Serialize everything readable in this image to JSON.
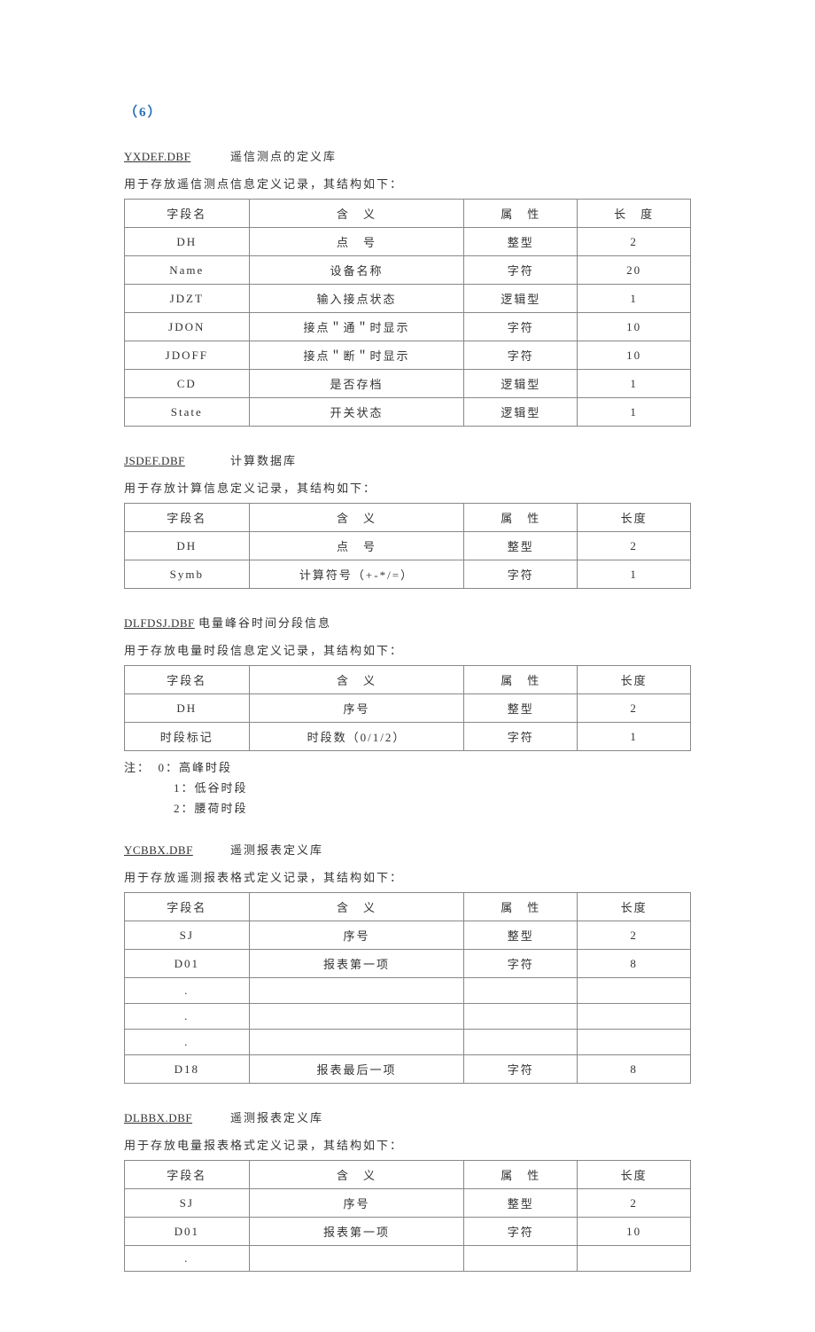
{
  "page_number": "（6）",
  "headers": {
    "field": "字段名",
    "meaning": "含　义",
    "attr": "属　性",
    "len": "长　度",
    "len_short": "长度"
  },
  "sections": [
    {
      "db_name": "YXDEF.DBF",
      "db_desc": "遥信测点的定义库",
      "sub": "用于存放遥信测点信息定义记录，其结构如下：",
      "len_header_key": "len",
      "rows": [
        {
          "name": "DH",
          "mean": "点　号",
          "attr": "整型",
          "len": "2"
        },
        {
          "name": "Name",
          "mean": "设备名称",
          "attr": "字符",
          "len": "20"
        },
        {
          "name": "JDZT",
          "mean": "输入接点状态",
          "attr": "逻辑型",
          "len": "1"
        },
        {
          "name": "JDON",
          "mean": "接点＂通＂时显示",
          "attr": "字符",
          "len": "10"
        },
        {
          "name": "JDOFF",
          "mean": "接点＂断＂时显示",
          "attr": "字符",
          "len": "10"
        },
        {
          "name": "CD",
          "mean": "是否存档",
          "attr": "逻辑型",
          "len": "1"
        },
        {
          "name": "State",
          "mean": "开关状态",
          "attr": "逻辑型",
          "len": "1"
        }
      ]
    },
    {
      "db_name": "JSDEF.DBF",
      "db_desc": "计算数据库",
      "sub": "用于存放计算信息定义记录，其结构如下：",
      "len_header_key": "len_short",
      "rows": [
        {
          "name": "字段名",
          "mean": "含　义",
          "attr": "属　性",
          "len": "长度",
          "is_header": true
        },
        {
          "name": "DH",
          "mean": "点　号",
          "attr": "整型",
          "len": "2"
        },
        {
          "name": "Symb",
          "mean": "计算符号（+-*/=）",
          "attr": "字符",
          "len": "1"
        }
      ]
    },
    {
      "db_name": "DLFDSJ.DBF",
      "db_desc": "电量峰谷时间分段信息",
      "sub": "用于存放电量时段信息定义记录，其结构如下：",
      "tight_name": true,
      "len_header_key": "len_short",
      "rows": [
        {
          "name": "DH",
          "mean": "序号",
          "attr": "整型",
          "len": "2"
        },
        {
          "name": "时段标记",
          "mean": "时段数（0/1/2）",
          "attr": "字符",
          "len": "1"
        }
      ],
      "notes": [
        "注：　0：高峰时段",
        "1：低谷时段",
        "2：腰荷时段"
      ]
    },
    {
      "db_name": "YCBBX.DBF",
      "db_desc": "遥测报表定义库",
      "sub": "用于存放遥测报表格式定义记录，其结构如下：",
      "len_header_key": "len_short",
      "rows": [
        {
          "name": "SJ",
          "mean": "序号",
          "attr": "整型",
          "len": "2"
        },
        {
          "name": "D01",
          "mean": "报表第一项",
          "attr": "字符",
          "len": "8"
        },
        {
          "name": ".",
          "mean": "",
          "attr": "",
          "len": ""
        },
        {
          "name": ".",
          "mean": "",
          "attr": "",
          "len": ""
        },
        {
          "name": ".",
          "mean": "",
          "attr": "",
          "len": ""
        },
        {
          "name": "D18",
          "mean": "报表最后一项",
          "attr": "字符",
          "len": "8"
        }
      ]
    },
    {
      "db_name": "DLBBX.DBF",
      "db_desc": "遥测报表定义库",
      "sub": "用于存放电量报表格式定义记录，其结构如下：",
      "len_header_key": "len_short",
      "rows": [
        {
          "name": "SJ",
          "mean": "序号",
          "attr": "整型",
          "len": "2"
        },
        {
          "name": "D01",
          "mean": "报表第一项",
          "attr": "字符",
          "len": "10"
        },
        {
          "name": ".",
          "mean": "",
          "attr": "",
          "len": ""
        }
      ]
    }
  ]
}
